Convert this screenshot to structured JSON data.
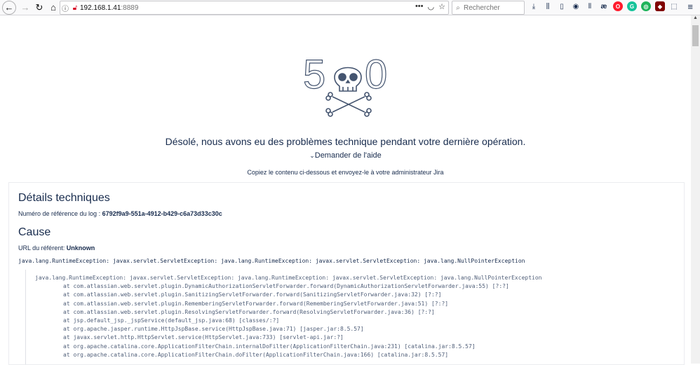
{
  "browser": {
    "url_host": "192.168.1.41",
    "url_port": ":8889",
    "search_placeholder": "Rechercher",
    "icons": [
      "back-arrow-icon",
      "forward-arrow-icon",
      "reload-icon",
      "home-icon",
      "info-icon",
      "insecure-lock-icon",
      "more-icon",
      "pocket-icon",
      "bookmark-star-icon",
      "search-icon",
      "downloads-icon",
      "library-icon",
      "sidebar-icon",
      "account-icon",
      "barcode-icon",
      "ae-icon",
      "opera-icon",
      "grammarly-icon",
      "tracker-icon",
      "ublock-icon",
      "screenshot-icon",
      "menu-icon"
    ],
    "ext_labels": {
      "ae": "æ",
      "grammarly": "G"
    },
    "colors": {
      "opera": "#ff1b2d",
      "grammarly": "#15c39a",
      "tracker": "#1fb35b",
      "ublock": "#800000"
    }
  },
  "error": {
    "code_left": "5",
    "code_right": "0",
    "message": "Désolé, nous avons eu des problèmes technique pendant votre dernière opération.",
    "help_link": "Demander de l'aide",
    "copy_instruction": "Copiez le contenu ci-dessous et envoyez-le à votre administrateur Jira"
  },
  "details": {
    "heading": "Détails techniques",
    "ref_label": "Numéro de référence du log : ",
    "ref_value": "6792f9a9-551a-4912-b429-c6a73d33c30c",
    "cause_heading": "Cause",
    "referrer_label": "URL du référent: ",
    "referrer_value": "Unknown",
    "exception": "java.lang.RuntimeException: javax.servlet.ServletException: java.lang.RuntimeException: javax.servlet.ServletException: java.lang.NullPointerException",
    "stack": [
      "java.lang.RuntimeException: javax.servlet.ServletException: java.lang.RuntimeException: javax.servlet.ServletException: java.lang.NullPointerException",
      "at com.atlassian.web.servlet.plugin.DynamicAuthorizationServletForwarder.forward(DynamicAuthorizationServletForwarder.java:55) [?:?]",
      "at com.atlassian.web.servlet.plugin.SanitizingServletForwarder.forward(SanitizingServletForwarder.java:32) [?:?]",
      "at com.atlassian.web.servlet.plugin.RememberingServletForwarder.forward(RememberingServletForwarder.java:51) [?:?]",
      "at com.atlassian.web.servlet.plugin.ResolvingServletForwarder.forward(ResolvingServletForwarder.java:36) [?:?]",
      "at jsp.default_jsp._jspService(default_jsp.java:68) [classes/:?]",
      "at org.apache.jasper.runtime.HttpJspBase.service(HttpJspBase.java:71) [jasper.jar:8.5.57]",
      "at javax.servlet.http.HttpServlet.service(HttpServlet.java:733) [servlet-api.jar:?]",
      "at org.apache.catalina.core.ApplicationFilterChain.internalDoFilter(ApplicationFilterChain.java:231) [catalina.jar:8.5.57]",
      "at org.apache.catalina.core.ApplicationFilterChain.doFilter(ApplicationFilterChain.java:166) [catalina.jar:8.5.57]"
    ]
  }
}
